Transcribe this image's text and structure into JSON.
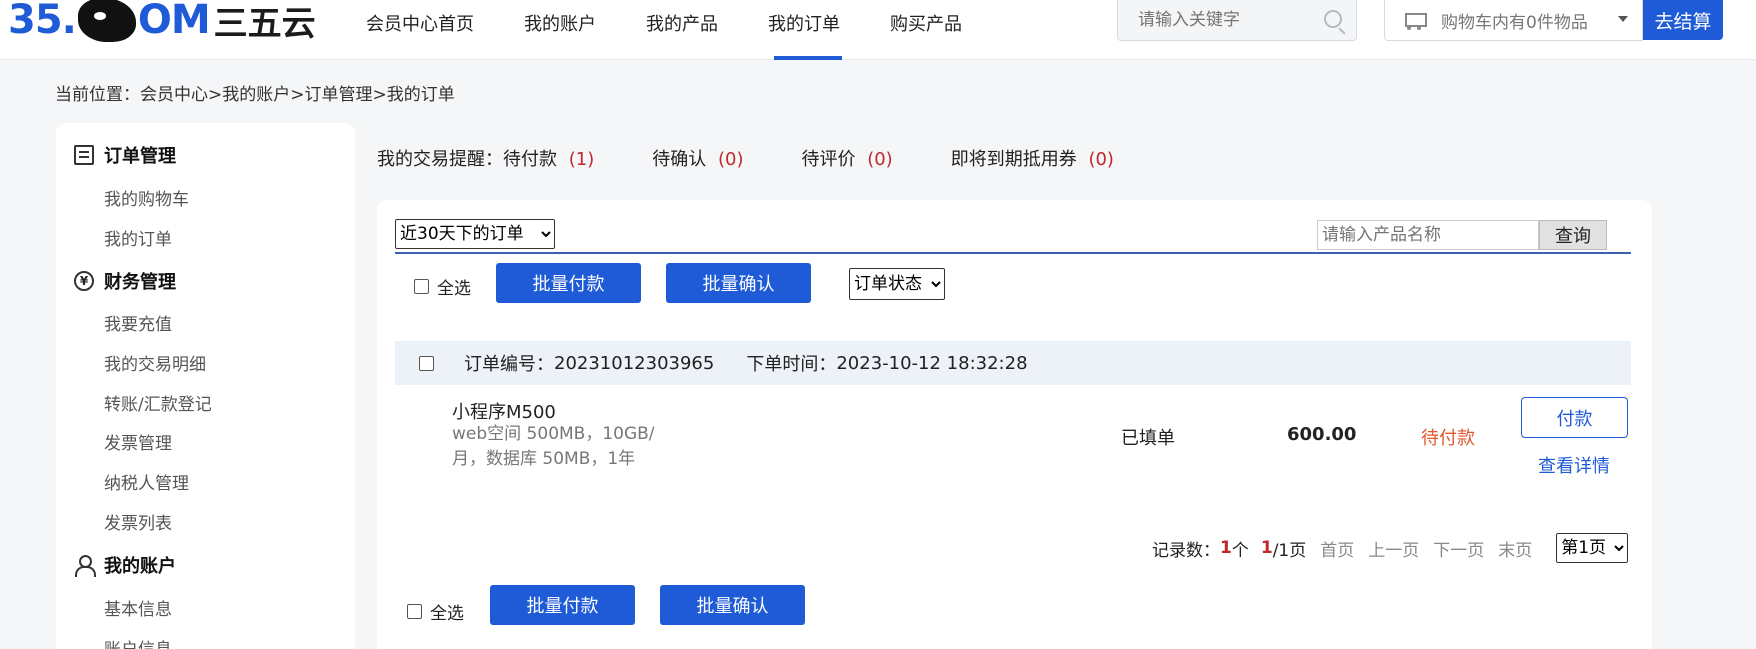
{
  "logo": {
    "num": "35.",
    "om": "OM",
    "cn": "三五云"
  },
  "nav": [
    "会员中心首页",
    "我的账户",
    "我的产品",
    "我的订单",
    "购买产品"
  ],
  "search": {
    "placeholder": "请输入关键字"
  },
  "cart": {
    "text": "购物车内有0件物品",
    "checkout": "去结算"
  },
  "breadcrumb": "当前位置：会员中心>我的账户>订单管理>我的订单",
  "sidebar": {
    "groups": [
      {
        "label": "订单管理",
        "items": [
          "我的购物车",
          "我的订单"
        ]
      },
      {
        "label": "财务管理",
        "items": [
          "我要充值",
          "我的交易明细",
          "转账/汇款登记",
          "发票管理",
          "纳税人管理",
          "发票列表"
        ]
      },
      {
        "label": "我的账户",
        "items": [
          "基本信息",
          "账户信息"
        ]
      }
    ]
  },
  "reminder": {
    "prefix": "我的交易提醒：",
    "items": [
      {
        "label": "待付款",
        "count": "(1)"
      },
      {
        "label": "待确认",
        "count": "(0)"
      },
      {
        "label": "待评价",
        "count": "(0)"
      },
      {
        "label": "即将到期抵用券",
        "count": "(0)"
      }
    ]
  },
  "filter": {
    "period": "近30天下的订单",
    "product_placeholder": "请输入产品名称",
    "query": "查询",
    "status": "订单状态"
  },
  "actions": {
    "select_all": "全选",
    "batch_pay": "批量付款",
    "batch_confirm": "批量确认"
  },
  "order": {
    "number_label": "订单编号：",
    "number": "20231012303965",
    "time_label": "下单时间：",
    "time": "2023-10-12 18:32:28",
    "product": "小程序M500",
    "desc": "web空间 500MB，10GB/月，数据库 50MB，1年",
    "fill_state": "已填单",
    "amount": "600.00",
    "status": "待付款",
    "pay": "付款",
    "detail": "查看详情"
  },
  "pager": {
    "records_label": "记录数：",
    "records": "1",
    "records_unit": "个",
    "page_cur": "1",
    "page_total": "/1页",
    "first": "首页",
    "prev": "上一页",
    "next": "下一页",
    "last": "末页",
    "select": "第1页"
  }
}
